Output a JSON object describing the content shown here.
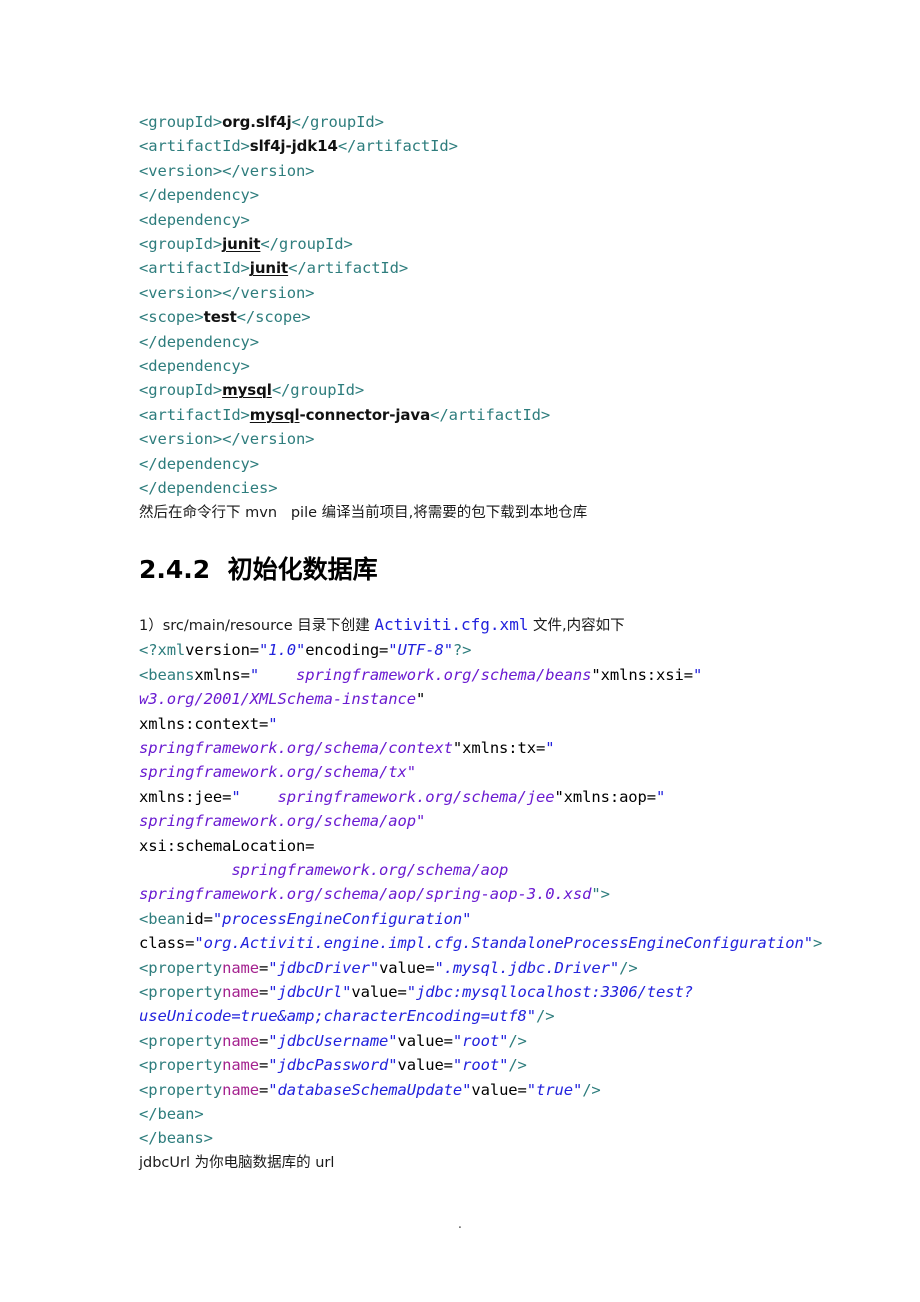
{
  "document": {
    "pom_snippet": {
      "lines": [
        {
          "id": "l1",
          "segments": [
            {
              "t": "tag",
              "v": "<groupId>"
            },
            {
              "t": "txt",
              "v": "org.slf4j"
            },
            {
              "t": "tag",
              "v": "</groupId>"
            }
          ]
        },
        {
          "id": "l2",
          "segments": [
            {
              "t": "tag",
              "v": "<artifactId>"
            },
            {
              "t": "txt",
              "v": "slf4j-jdk14"
            },
            {
              "t": "tag",
              "v": "</artifactId>"
            }
          ]
        },
        {
          "id": "l3",
          "segments": [
            {
              "t": "tag",
              "v": "<version></version>"
            }
          ]
        },
        {
          "id": "l4",
          "segments": [
            {
              "t": "tag",
              "v": "</dependency>"
            }
          ]
        },
        {
          "id": "l5",
          "segments": [
            {
              "t": "tag",
              "v": "<dependency>"
            }
          ]
        },
        {
          "id": "l6",
          "segments": [
            {
              "t": "tag",
              "v": "<groupId>"
            },
            {
              "t": "txt-u",
              "v": "junit"
            },
            {
              "t": "tag",
              "v": "</groupId>"
            }
          ]
        },
        {
          "id": "l7",
          "segments": [
            {
              "t": "tag",
              "v": "<artifactId>"
            },
            {
              "t": "txt-u",
              "v": "junit"
            },
            {
              "t": "tag",
              "v": "</artifactId>"
            }
          ]
        },
        {
          "id": "l8",
          "segments": [
            {
              "t": "tag",
              "v": "<version></version>"
            }
          ]
        },
        {
          "id": "l9",
          "segments": [
            {
              "t": "tag",
              "v": "<scope>"
            },
            {
              "t": "txt",
              "v": "test"
            },
            {
              "t": "tag",
              "v": "</scope>"
            }
          ]
        },
        {
          "id": "l10",
          "segments": [
            {
              "t": "tag",
              "v": "</dependency>"
            }
          ]
        },
        {
          "id": "l11",
          "segments": [
            {
              "t": "tag",
              "v": "<dependency>"
            }
          ]
        },
        {
          "id": "l12",
          "segments": [
            {
              "t": "tag",
              "v": "<groupId>"
            },
            {
              "t": "txt-u",
              "v": "mysql"
            },
            {
              "t": "tag",
              "v": "</groupId>"
            }
          ]
        },
        {
          "id": "l13",
          "segments": [
            {
              "t": "tag",
              "v": "<artifactId>"
            },
            {
              "t": "txt-u",
              "v": "mysql"
            },
            {
              "t": "txt",
              "v": "-connector-java"
            },
            {
              "t": "tag",
              "v": "</artifactId>"
            }
          ]
        },
        {
          "id": "l14",
          "segments": [
            {
              "t": "tag",
              "v": "<version></version>"
            }
          ]
        },
        {
          "id": "l15",
          "segments": [
            {
              "t": "tag",
              "v": "</dependency>"
            }
          ]
        },
        {
          "id": "l16",
          "segments": [
            {
              "t": "tag",
              "v": "</dependencies>"
            }
          ]
        }
      ]
    },
    "note_after_pom": "然后在命令行下 mvn   pile 编译当前项目,将需要的包下载到本地仓库",
    "section_heading": {
      "number": "2.4.2",
      "title": "初始化数据库",
      "full": "2.4.2  初始化数据库"
    },
    "intro_line": {
      "prefix": "1）src/main/resource 目录下创建 ",
      "filename": "Activiti.cfg.xml",
      "suffix": " 文件,内容如下"
    },
    "config_snippet": {
      "lines": [
        {
          "id": "c1",
          "segments": [
            {
              "t": "tag",
              "v": "<?xml"
            },
            {
              "t": "attr",
              "v": "version="
            },
            {
              "t": "val",
              "v": "\"1.0\""
            },
            {
              "t": "attr",
              "v": "encoding="
            },
            {
              "t": "val",
              "v": "\"UTF-8\""
            },
            {
              "t": "tag",
              "v": "?>"
            }
          ]
        },
        {
          "id": "c2",
          "segments": [
            {
              "t": "tag",
              "v": "<beans"
            },
            {
              "t": "attr",
              "v": "xmlns="
            },
            {
              "t": "val",
              "v": "\""
            },
            {
              "t": "url",
              "v": "    springframework.org/schema/beans"
            },
            {
              "t": "attr",
              "v": "\"xmlns:xsi="
            },
            {
              "t": "val",
              "v": "\""
            }
          ]
        },
        {
          "id": "c3",
          "segments": [
            {
              "t": "url",
              "v": "w3.org/2001/XMLSchema-instance"
            },
            {
              "t": "attr",
              "v": "\""
            }
          ]
        },
        {
          "id": "c4",
          "segments": [
            {
              "t": "attr",
              "v": "xmlns:context="
            },
            {
              "t": "val",
              "v": "\""
            }
          ]
        },
        {
          "id": "c5",
          "segments": [
            {
              "t": "url",
              "v": "springframework.org/schema/context"
            },
            {
              "t": "attr",
              "v": "\"xmlns:tx="
            },
            {
              "t": "val",
              "v": "\""
            }
          ]
        },
        {
          "id": "c6",
          "segments": [
            {
              "t": "url",
              "v": "springframework.org/schema/tx\""
            }
          ]
        },
        {
          "id": "c7",
          "segments": [
            {
              "t": "attr",
              "v": "xmlns:jee="
            },
            {
              "t": "val",
              "v": "\""
            },
            {
              "t": "url",
              "v": "    springframework.org/schema/jee"
            },
            {
              "t": "attr",
              "v": "\"xmlns:aop="
            },
            {
              "t": "val",
              "v": "\""
            }
          ]
        },
        {
          "id": "c8",
          "segments": [
            {
              "t": "url",
              "v": "springframework.org/schema/aop\""
            }
          ]
        },
        {
          "id": "c9",
          "segments": [
            {
              "t": "attr",
              "v": "xsi:schemaLocation="
            }
          ]
        },
        {
          "id": "c10",
          "segments": [
            {
              "t": "url",
              "v": "          springframework.org/schema/aop"
            }
          ]
        },
        {
          "id": "c11",
          "segments": [
            {
              "t": "url",
              "v": "springframework.org/schema/aop/spring-aop-3.0.xsd"
            },
            {
              "t": "tag",
              "v": "\">"
            }
          ]
        },
        {
          "id": "c12",
          "segments": [
            {
              "t": "tag",
              "v": "<bean"
            },
            {
              "t": "attr",
              "v": "id="
            },
            {
              "t": "val",
              "v": "\"processEngineConfiguration\""
            }
          ]
        },
        {
          "id": "c13",
          "segments": [
            {
              "t": "attr",
              "v": "class="
            },
            {
              "t": "val",
              "v": "\"org.Activiti.engine.impl.cfg.StandaloneProcessEngineConfiguration\""
            },
            {
              "t": "tag",
              "v": ">"
            }
          ]
        },
        {
          "id": "c14",
          "segments": [
            {
              "t": "tag",
              "v": "<property"
            },
            {
              "t": "attrname",
              "v": "name"
            },
            {
              "t": "attr",
              "v": "="
            },
            {
              "t": "val",
              "v": "\"jdbcDriver\""
            },
            {
              "t": "attr",
              "v": "value="
            },
            {
              "t": "val",
              "v": "\".mysql.jdbc.Driver\""
            },
            {
              "t": "tag",
              "v": "/>"
            }
          ]
        },
        {
          "id": "c15",
          "segments": [
            {
              "t": "tag",
              "v": "<property"
            },
            {
              "t": "attrname",
              "v": "name"
            },
            {
              "t": "attr",
              "v": "="
            },
            {
              "t": "val",
              "v": "\"jdbcUrl\""
            },
            {
              "t": "attr",
              "v": "value="
            },
            {
              "t": "val",
              "v": "\"jdbc:mysqllocalhost:3306/test?useUnicode=true&amp;characterEncoding=utf8\""
            },
            {
              "t": "tag",
              "v": "/>"
            }
          ]
        },
        {
          "id": "c16",
          "segments": [
            {
              "t": "tag",
              "v": "<property"
            },
            {
              "t": "attrname",
              "v": "name"
            },
            {
              "t": "attr",
              "v": "="
            },
            {
              "t": "val",
              "v": "\"jdbcUsername\""
            },
            {
              "t": "attr",
              "v": "value="
            },
            {
              "t": "val",
              "v": "\"root\""
            },
            {
              "t": "tag",
              "v": "/>"
            }
          ]
        },
        {
          "id": "c17",
          "segments": [
            {
              "t": "tag",
              "v": "<property"
            },
            {
              "t": "attrname",
              "v": "name"
            },
            {
              "t": "attr",
              "v": "="
            },
            {
              "t": "val",
              "v": "\"jdbcPassword\""
            },
            {
              "t": "attr",
              "v": "value="
            },
            {
              "t": "val",
              "v": "\"root\""
            },
            {
              "t": "tag",
              "v": "/>"
            }
          ]
        },
        {
          "id": "c18",
          "segments": [
            {
              "t": "tag",
              "v": "<property"
            },
            {
              "t": "attrname",
              "v": "name"
            },
            {
              "t": "attr",
              "v": "="
            },
            {
              "t": "val",
              "v": "\"databaseSchemaUpdate\""
            },
            {
              "t": "attr",
              "v": "value="
            },
            {
              "t": "val",
              "v": "\"true\""
            },
            {
              "t": "tag",
              "v": "/>"
            }
          ]
        },
        {
          "id": "c19",
          "segments": [
            {
              "t": "tag",
              "v": "</bean>"
            }
          ]
        },
        {
          "id": "c20",
          "segments": [
            {
              "t": "tag",
              "v": "</beans>"
            }
          ]
        }
      ]
    },
    "note_after_config": "jdbcUrl 为你电脑数据库的 url",
    "footer": "."
  },
  "colors": {
    "tag": "#2e7d7d",
    "attribute_value": "#2222dd",
    "url_value": "#6a1bd1",
    "attribute_name_highlight": "#a4228f",
    "body_text": "#1a1a1a",
    "filename_blue": "#2222dd",
    "page_background": "#ffffff"
  }
}
